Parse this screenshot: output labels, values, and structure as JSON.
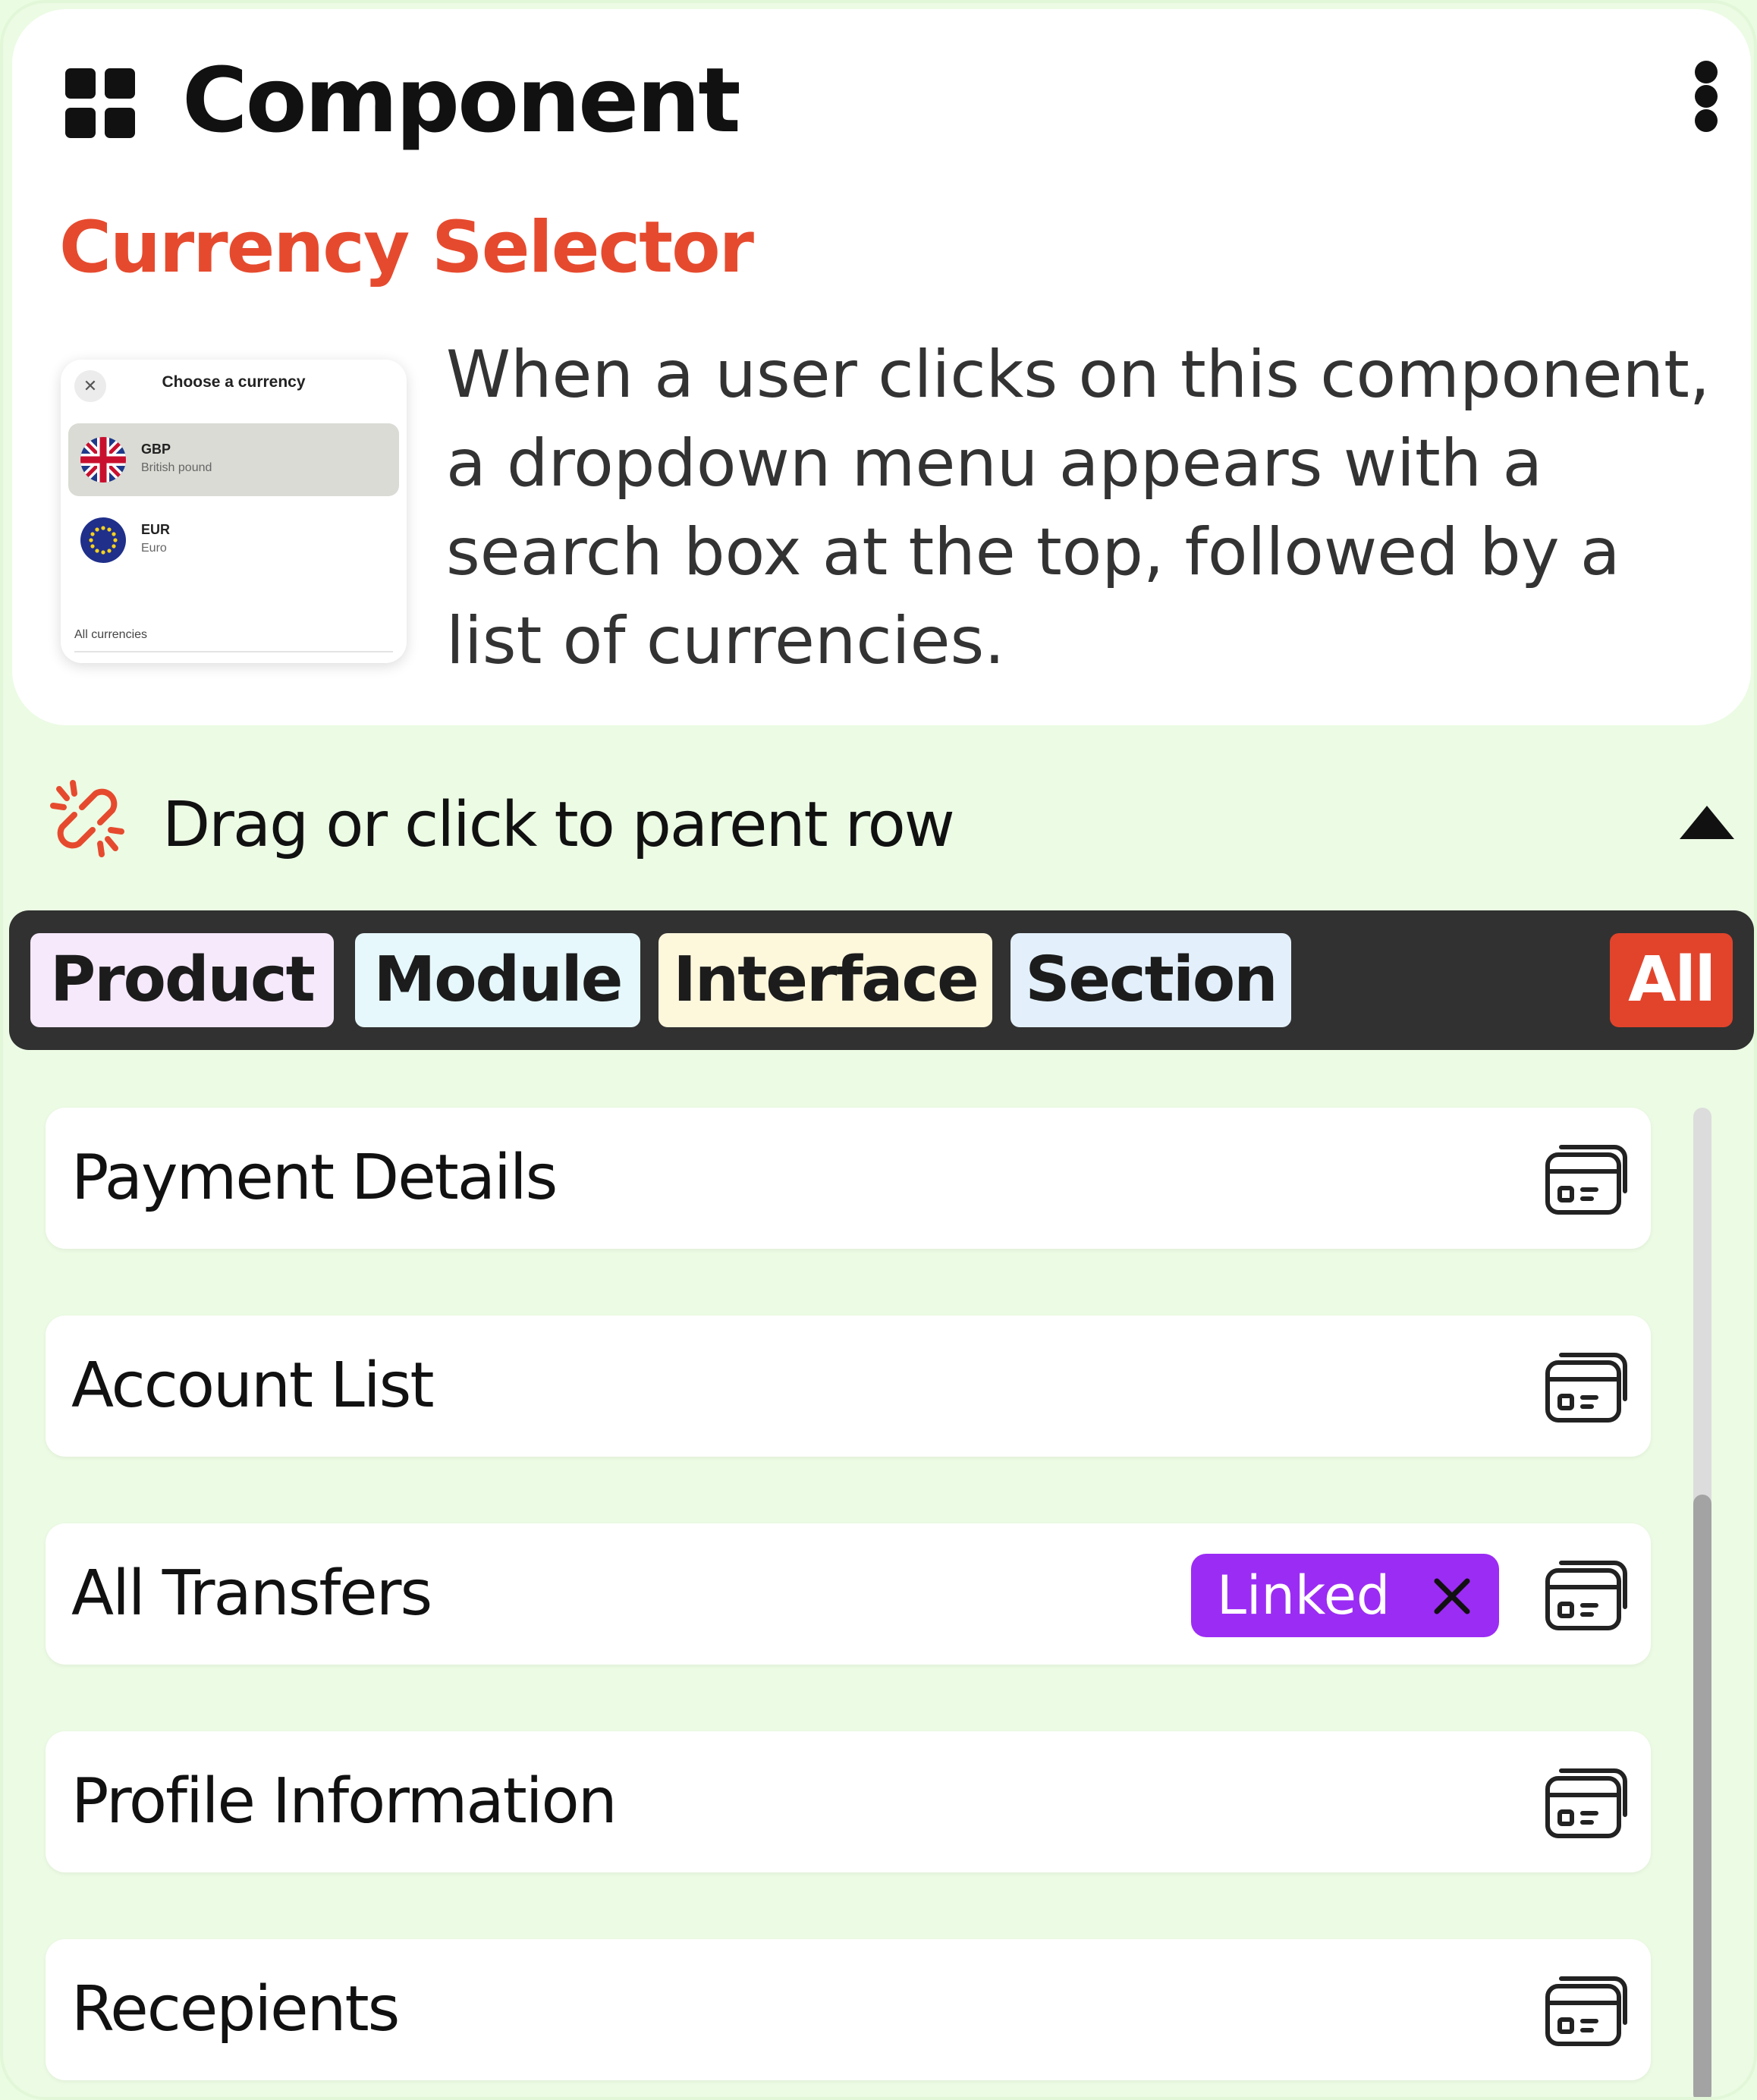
{
  "header": {
    "title": "Component",
    "subtitle": "Currency Selector",
    "description": "When a user clicks on this component, a dropdown menu appears with a search box at the top, followed by a list of currencies."
  },
  "preview": {
    "title": "Choose a currency",
    "close_glyph": "✕",
    "currencies": [
      {
        "code": "GBP",
        "name": "British pound",
        "selected": true
      },
      {
        "code": "EUR",
        "name": "Euro",
        "selected": false
      }
    ],
    "footer": "All currencies"
  },
  "parent": {
    "label": "Drag or click to parent row",
    "accent": "#e64a2e"
  },
  "filters": [
    {
      "label": "Product",
      "color": "#f6e9fc"
    },
    {
      "label": "Module",
      "color": "#e6f8fb"
    },
    {
      "label": "Interface",
      "color": "#fdf7dc"
    },
    {
      "label": "Section",
      "color": "#e3f0fb"
    },
    {
      "label": "All",
      "color": "#e2442b",
      "active": true
    }
  ],
  "rows": [
    {
      "label": "Payment Details",
      "linked": false
    },
    {
      "label": "Account List",
      "linked": false
    },
    {
      "label": "All Transfers",
      "linked": true,
      "badge": "Linked"
    },
    {
      "label": "Profile Information",
      "linked": false
    },
    {
      "label": "Recepients",
      "linked": false
    }
  ],
  "colors": {
    "background": "#ecfbe4",
    "title_accent": "#e64a2e",
    "linked_badge": "#9b2cf4",
    "filterbar": "#313131"
  },
  "icons": [
    "grid-icon",
    "kebab-menu-icon",
    "link-icon",
    "triangle-up-icon",
    "card-icon",
    "close-icon"
  ]
}
